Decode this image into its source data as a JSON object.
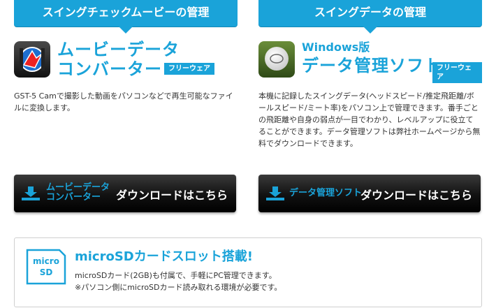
{
  "left": {
    "heading": "スイングチェックムービーの管理",
    "title_line1": "ムービーデータ",
    "title_line2": "コンバーター",
    "badge": "フリーウェア",
    "description": "GST-5 Camで撮影した動画をパソコンなどで再生可能なファイルに変換します。",
    "button_app_line1": "ムービーデータ",
    "button_app_line2": "コンバーター",
    "button_text": "ダウンロードはこちら",
    "icon": "movie-converter-icon"
  },
  "right": {
    "heading": "スイングデータの管理",
    "platform": "Windows版",
    "title": "データ管理ソフト",
    "badge": "フリーウェア",
    "description": "本機に記録したスイングデータ(ヘッドスピード/推定飛距離/ボールスピード/ミート率)をパソコン上で管理できます。番手ごとの飛距離や自身の弱点が一目でわかり、レベルアップに役立てることができます。データ管理ソフトは弊社ホームページから無料でダウンロードできます。",
    "button_app": "データ管理ソフト",
    "button_text": "ダウンロードはこちら",
    "icon": "golf-ball-icon"
  },
  "microsd": {
    "card_line1": "micro",
    "card_line2": "SD",
    "title": "microSDカードスロット搭載!",
    "line1": "microSDカード(2GB)も付属で、手軽にPC管理できます。",
    "line2": "※パソコン側にmicroSDカード読み取れる環境が必要です。"
  },
  "colors": {
    "accent": "#1aa3d9",
    "button": "#111111"
  }
}
